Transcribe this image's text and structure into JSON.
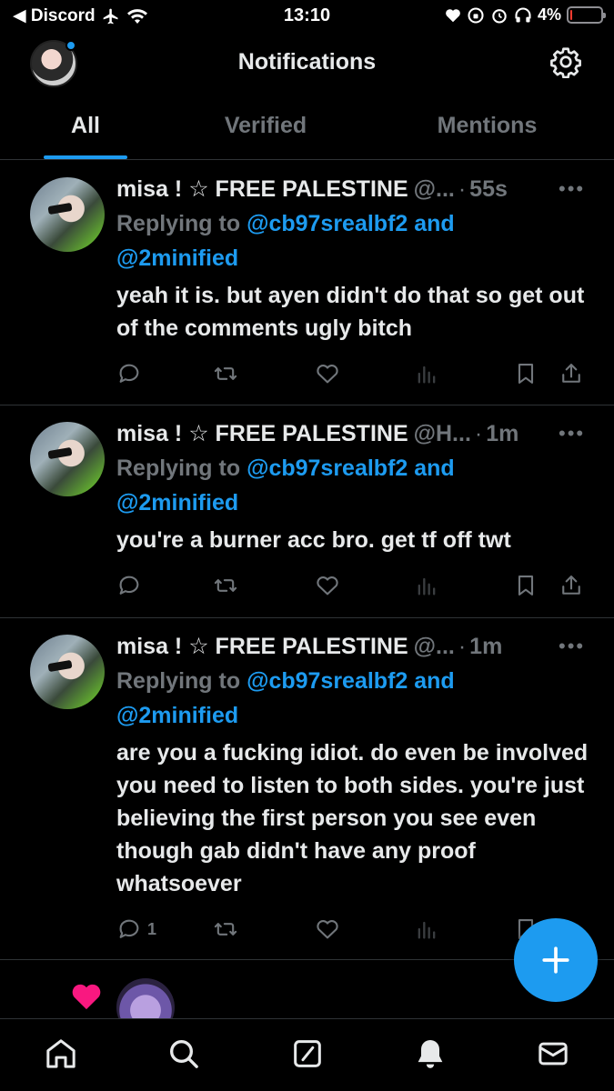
{
  "status_bar": {
    "back_app": "◀ Discord",
    "time": "13:10",
    "battery": "4%",
    "battery_level": 0.04
  },
  "header": {
    "title": "Notifications"
  },
  "tabs": [
    {
      "label": "All",
      "active": true
    },
    {
      "label": "Verified",
      "active": false
    },
    {
      "label": "Mentions",
      "active": false
    }
  ],
  "tweets": [
    {
      "name": "misa ! ☆ FREE PALESTINE",
      "handle": "@...",
      "time": "55s",
      "replying_prefix": "Replying to",
      "mention_1": "@cb97srealbf2 and",
      "mention_2": "@2minified",
      "text": "yeah it is. but ayen didn't do that so get out of the comments ugly bitch",
      "reply_count": ""
    },
    {
      "name": "misa ! ☆ FREE PALESTINE",
      "handle": "@H...",
      "time": "1m",
      "replying_prefix": "Replying to",
      "mention_1": "@cb97srealbf2 and",
      "mention_2": "@2minified",
      "text": "you're a burner acc bro. get tf off twt",
      "reply_count": ""
    },
    {
      "name": "misa ! ☆ FREE PALESTINE",
      "handle": "@...",
      "time": "1m",
      "replying_prefix": "Replying to",
      "mention_1": "@cb97srealbf2 and",
      "mention_2": "@2minified",
      "text": "are you a fucking idiot. do even be involved you need to listen to both sides. you're just believing the first person you see even though gab didn't have any proof whatsoever",
      "reply_count": "1"
    }
  ],
  "colors": {
    "accent": "#1d9bf0",
    "secondary_text": "#71767b",
    "primary_text": "#e7e9ea",
    "like": "#f91880"
  }
}
